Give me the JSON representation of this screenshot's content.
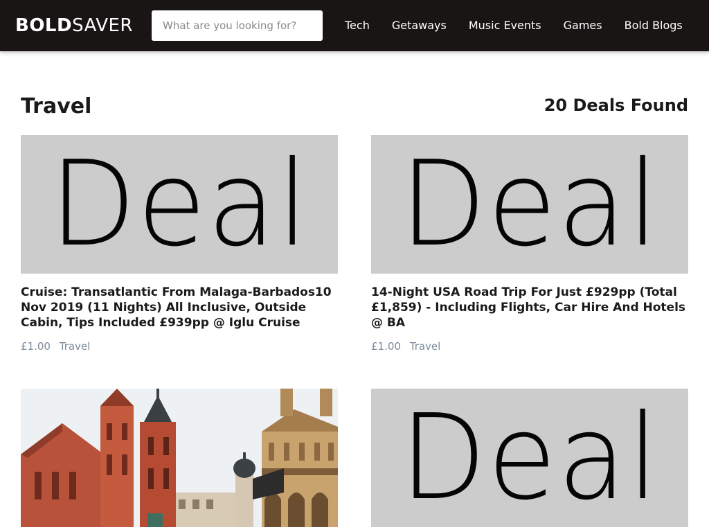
{
  "header": {
    "logo_bold": "BOLD",
    "logo_light": "SAVER",
    "search_placeholder": "What are you looking for?",
    "nav": [
      "Tech",
      "Getaways",
      "Music Events",
      "Games",
      "Bold Blogs"
    ]
  },
  "page": {
    "title": "Travel",
    "deal_count": "20 Deals Found"
  },
  "deals": [
    {
      "image_type": "placeholder",
      "image_text": "Deal",
      "title": "Cruise: Transatlantic From Malaga-Barbados10 Nov 2019 (11 Nights) All Inclusive, Outside Cabin, Tips Included £939pp @ Iglu Cruise",
      "price": "£1.00",
      "category": "Travel"
    },
    {
      "image_type": "placeholder",
      "image_text": "Deal",
      "title": "14-Night USA Road Trip For Just £929pp (Total £1,859) - Including Flights, Car Hire And Hotels @ BA",
      "price": "£1.00",
      "category": "Travel"
    },
    {
      "image_type": "photo",
      "image_subject": "krakow-old-town-photo"
    },
    {
      "image_type": "placeholder",
      "image_text": "Deal"
    }
  ],
  "colors": {
    "header_bg": "#1a1515",
    "placeholder_bg": "#cccccc",
    "meta_text": "#7b8a9a"
  }
}
